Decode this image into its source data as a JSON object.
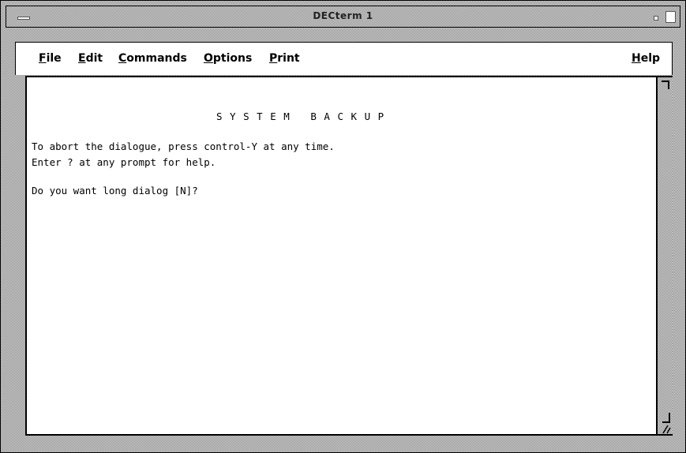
{
  "window": {
    "title": "DECterm 1"
  },
  "menu": {
    "items": [
      {
        "id": "file",
        "mnemonic": "F",
        "rest": "ile"
      },
      {
        "id": "edit",
        "mnemonic": "E",
        "rest": "dit"
      },
      {
        "id": "commands",
        "mnemonic": "C",
        "rest": "ommands"
      },
      {
        "id": "options",
        "mnemonic": "O",
        "rest": "ptions"
      },
      {
        "id": "print",
        "mnemonic": "P",
        "rest": "rint"
      }
    ],
    "help": {
      "mnemonic": "H",
      "rest": "elp"
    }
  },
  "terminal": {
    "heading": "S Y S T E M   B A C K U P",
    "lines": [
      "To abort the dialogue, press control-Y at any time.",
      "Enter ? at any prompt for help.",
      "",
      "Do you want long dialog [N]?"
    ]
  },
  "icons": {
    "system_menu": "window-menu-icon",
    "minimize": "minimize-icon",
    "maximize": "maximize-icon",
    "resize": "resize-corner-icon"
  }
}
